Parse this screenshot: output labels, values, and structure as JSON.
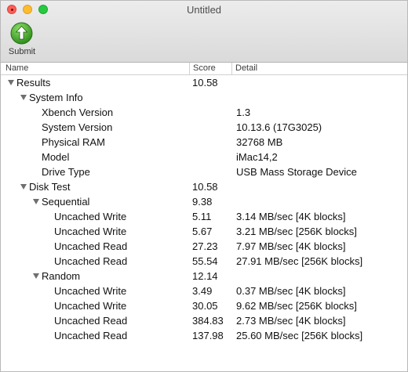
{
  "window": {
    "title": "Untitled"
  },
  "toolbar": {
    "submit_label": "Submit"
  },
  "columns": {
    "name": "Name",
    "score": "Score",
    "detail": "Detail"
  },
  "rows": [
    {
      "name": "Results",
      "score": "10.58",
      "detail": "",
      "depth": 0,
      "expandable": true
    },
    {
      "name": "System Info",
      "score": "",
      "detail": "",
      "depth": 1,
      "expandable": true
    },
    {
      "name": "Xbench Version",
      "score": "",
      "detail": "1.3",
      "depth": 2,
      "expandable": false
    },
    {
      "name": "System Version",
      "score": "",
      "detail": "10.13.6 (17G3025)",
      "depth": 2,
      "expandable": false
    },
    {
      "name": "Physical RAM",
      "score": "",
      "detail": "32768 MB",
      "depth": 2,
      "expandable": false
    },
    {
      "name": "Model",
      "score": "",
      "detail": "iMac14,2",
      "depth": 2,
      "expandable": false
    },
    {
      "name": "Drive Type",
      "score": "",
      "detail": "USB Mass Storage Device",
      "depth": 2,
      "expandable": false
    },
    {
      "name": "Disk Test",
      "score": "10.58",
      "detail": "",
      "depth": 1,
      "expandable": true
    },
    {
      "name": "Sequential",
      "score": "9.38",
      "detail": "",
      "depth": 2,
      "expandable": true
    },
    {
      "name": "Uncached Write",
      "score": "5.11",
      "detail": "3.14 MB/sec [4K blocks]",
      "depth": 3,
      "expandable": false
    },
    {
      "name": "Uncached Write",
      "score": "5.67",
      "detail": "3.21 MB/sec [256K blocks]",
      "depth": 3,
      "expandable": false
    },
    {
      "name": "Uncached Read",
      "score": "27.23",
      "detail": "7.97 MB/sec [4K blocks]",
      "depth": 3,
      "expandable": false
    },
    {
      "name": "Uncached Read",
      "score": "55.54",
      "detail": "27.91 MB/sec [256K blocks]",
      "depth": 3,
      "expandable": false
    },
    {
      "name": "Random",
      "score": "12.14",
      "detail": "",
      "depth": 2,
      "expandable": true
    },
    {
      "name": "Uncached Write",
      "score": "3.49",
      "detail": "0.37 MB/sec [4K blocks]",
      "depth": 3,
      "expandable": false
    },
    {
      "name": "Uncached Write",
      "score": "30.05",
      "detail": "9.62 MB/sec [256K blocks]",
      "depth": 3,
      "expandable": false
    },
    {
      "name": "Uncached Read",
      "score": "384.83",
      "detail": "2.73 MB/sec [4K blocks]",
      "depth": 3,
      "expandable": false
    },
    {
      "name": "Uncached Read",
      "score": "137.98",
      "detail": "25.60 MB/sec [256K blocks]",
      "depth": 3,
      "expandable": false
    }
  ]
}
